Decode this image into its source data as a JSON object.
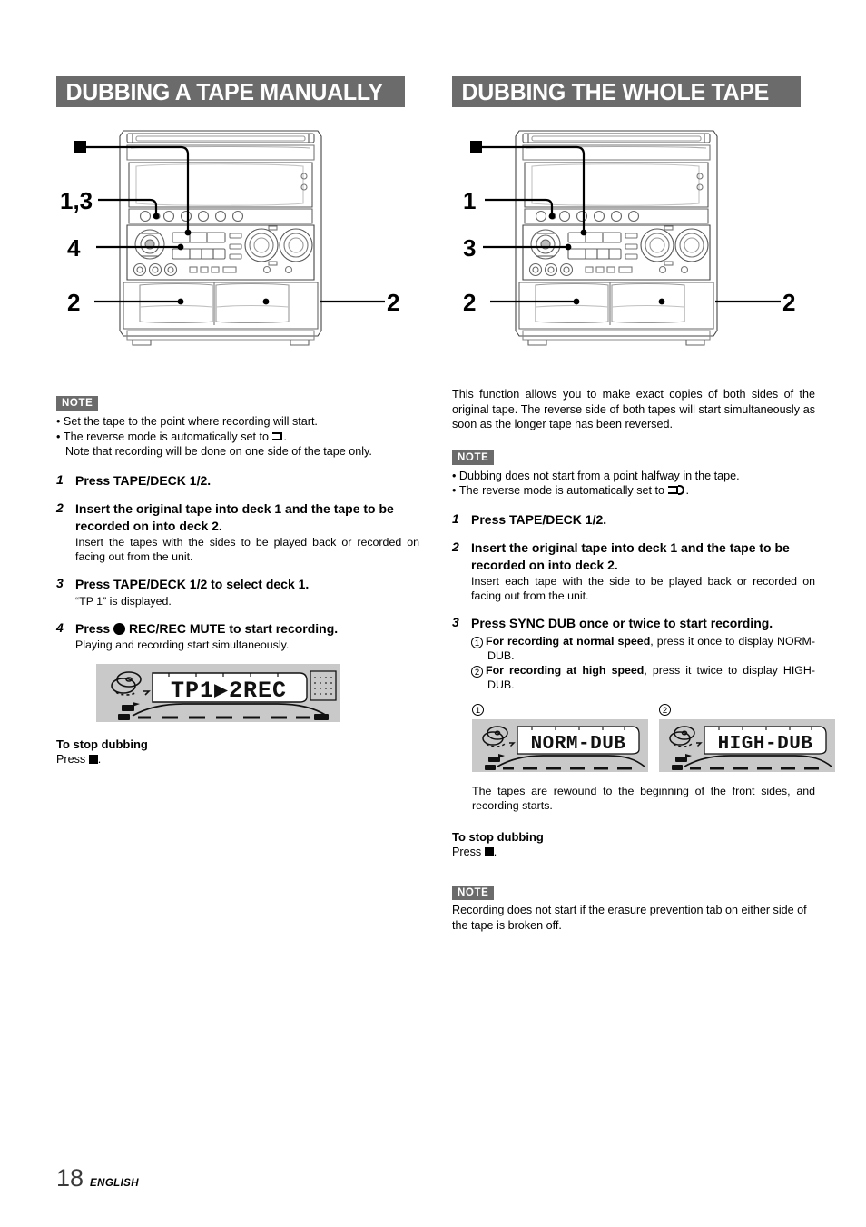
{
  "page": {
    "number": "18",
    "language": "ENGLISH"
  },
  "left_section": {
    "title": "DUBBING A TAPE MANUALLY",
    "diagram": {
      "name": "stereo-system-front-view",
      "callouts": [
        {
          "label": "■",
          "position": "top-left"
        },
        {
          "label": "1,3",
          "position": "left"
        },
        {
          "label": "4",
          "position": "left"
        },
        {
          "label": "2",
          "position": "left-bottom"
        },
        {
          "label": "2",
          "position": "right-bottom"
        }
      ]
    },
    "note": {
      "badge": "NOTE",
      "items": [
        "Set the tape to the point where recording will start.",
        "The reverse mode is automatically set to",
        "Note that recording will be done on one side of the tape only."
      ]
    },
    "steps": [
      {
        "num": "1",
        "title": "Press TAPE/DECK 1/2.",
        "body": ""
      },
      {
        "num": "2",
        "title": "Insert the original tape into deck 1 and the tape to be recorded on into deck 2.",
        "body": "Insert the tapes with the sides to be played back or recorded on facing out from the unit."
      },
      {
        "num": "3",
        "title": "Press TAPE/DECK 1/2 to select deck 1.",
        "body": "“TP 1” is displayed."
      },
      {
        "num": "4",
        "title_before": "Press",
        "title_after": "REC/REC MUTE to start recording.",
        "body": "Playing and recording start simultaneously."
      }
    ],
    "display": {
      "text": "TP1▶2REC"
    },
    "stop": {
      "heading": "To stop dubbing",
      "line_before": "Press",
      "line_after": "."
    }
  },
  "right_section": {
    "title": "DUBBING THE WHOLE TAPE",
    "diagram": {
      "name": "stereo-system-front-view",
      "callouts": [
        {
          "label": "■",
          "position": "top-left"
        },
        {
          "label": "1",
          "position": "left"
        },
        {
          "label": "3",
          "position": "left"
        },
        {
          "label": "2",
          "position": "left-bottom"
        },
        {
          "label": "2",
          "position": "right-bottom"
        }
      ]
    },
    "intro": "This function allows you to make exact copies of both sides of the original tape. The reverse side of both tapes will start simultaneously as soon as the longer tape has been reversed.",
    "note": {
      "badge": "NOTE",
      "items": [
        "Dubbing does not start from a point halfway in the tape.",
        "The reverse mode is automatically set to"
      ]
    },
    "steps": [
      {
        "num": "1",
        "title": "Press TAPE/DECK 1/2.",
        "body": ""
      },
      {
        "num": "2",
        "title": "Insert the original tape into deck 1 and the tape to be recorded on into deck 2.",
        "body": "Insert each tape with the side to be played back or recorded on facing out from the unit."
      },
      {
        "num": "3",
        "title": "Press SYNC DUB once or twice to start recording.",
        "sub_items": [
          {
            "marker": "1",
            "bold": "For recording at normal speed",
            "rest": ", press it once to display NORM-DUB."
          },
          {
            "marker": "2",
            "bold": "For recording at high speed",
            "rest": ", press it twice to display HIGH-DUB."
          }
        ]
      }
    ],
    "displays": [
      {
        "caption": "1",
        "text": "NORM-DUB"
      },
      {
        "caption": "2",
        "text": "HIGH-DUB"
      }
    ],
    "after_display_text": "The tapes are rewound to the beginning of the front sides, and recording starts.",
    "stop": {
      "heading": "To stop dubbing",
      "line_before": "Press",
      "line_after": "."
    },
    "note2": {
      "badge": "NOTE",
      "text": "Recording does not start if the erasure prevention tab on either side of the tape is broken off."
    }
  },
  "colors": {
    "header_bar": "#6b6b6b",
    "header_text": "#ffffff",
    "lcd_background": "#c9c9c9",
    "body_text": "#000000"
  }
}
